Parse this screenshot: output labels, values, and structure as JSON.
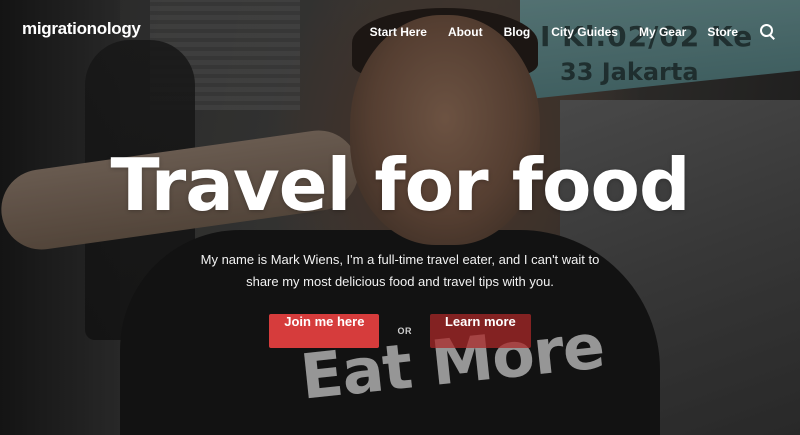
{
  "brand": {
    "logo_text": "migrationology",
    "accent_color": "#d63c3c"
  },
  "nav": {
    "items": [
      {
        "label": "Start Here"
      },
      {
        "label": "About"
      },
      {
        "label": "Blog"
      },
      {
        "label": "City Guides"
      },
      {
        "label": "My Gear"
      },
      {
        "label": "Store"
      }
    ],
    "search_icon": "search-icon"
  },
  "hero": {
    "headline": "Travel for food",
    "subtext": "My name is Mark Wiens, I'm a full-time travel eater, and I can't wait to share my most delicious food and travel tips with you.",
    "primary_cta": "Join me here",
    "separator": "OR",
    "secondary_cta": "Learn more",
    "background_sign_line1": "I Kl.02/02 Ke",
    "background_sign_line2": "33 Jakarta",
    "shirt_print": "Eat More"
  }
}
